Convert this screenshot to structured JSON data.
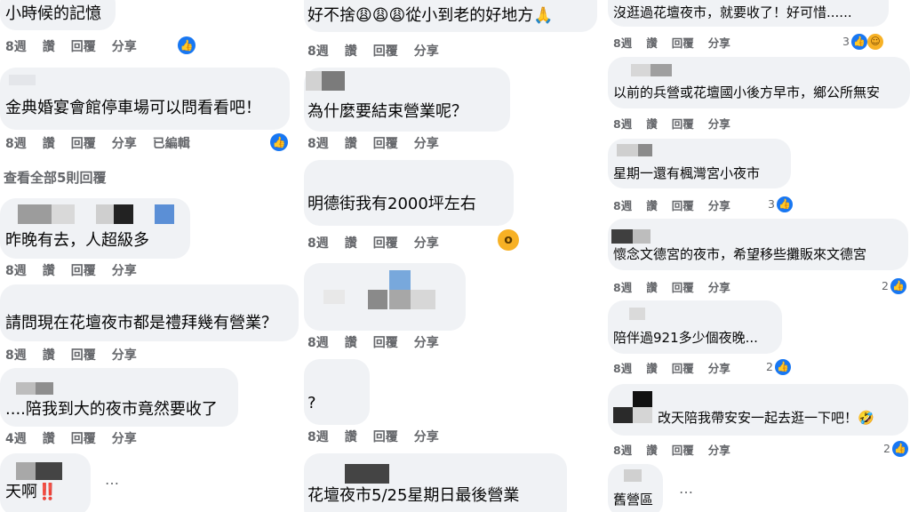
{
  "meta": {
    "reply_label": "回覆",
    "share_label": "分享",
    "edited_label": "已編輯"
  },
  "col1": {
    "c1": {
      "text": "小時候的記憶",
      "time": "8週",
      "read": "讚"
    },
    "c2": {
      "text": "金典婚宴會館停車場可以問看看吧！",
      "time": "8週",
      "read": "讚"
    },
    "view_all": "查看全部5則回覆",
    "c3": {
      "text": "昨晚有去，人超級多",
      "time": "8週",
      "read": "讚"
    },
    "c4": {
      "text": "請問現在花壇夜市都是禮拜幾有營業？",
      "time": "8週",
      "read": "讚"
    },
    "c5": {
      "text": "....陪我到大的夜市竟然要收了",
      "time": "4週",
      "read": "讚"
    },
    "c6": {
      "text": "天啊",
      "emoji": "‼️",
      "more": "…"
    }
  },
  "col2": {
    "c1": {
      "text_a": "好不捨",
      "emoji": "😩😩😩",
      "text_b": "從小到老的好地方",
      "pray": "🙏",
      "time": "8週",
      "read": "讚"
    },
    "c2": {
      "text": "為什麼要結束營業呢？",
      "time": "8週",
      "read": "讚"
    },
    "c3": {
      "text": "明德街我有2000坪左右",
      "time": "8週",
      "read": "讚"
    },
    "c4": {
      "time": "8週",
      "read": "讚"
    },
    "c5": {
      "text": "?",
      "time": "8週",
      "read": "讚"
    },
    "c6": {
      "text": "花壇夜市5/25星期日最後營業"
    }
  },
  "col3": {
    "c1": {
      "text": "沒逛過花壇夜市，就要收了！好可惜......",
      "time": "8週",
      "read": "讚",
      "count": "3"
    },
    "c2": {
      "text": "以前的兵營或花壇國小後方早市，鄉公所無安",
      "time": "8週",
      "read": "讚"
    },
    "c3": {
      "text": "星期一還有楓灣宮小夜市",
      "time": "8週",
      "read": "讚",
      "count": "3"
    },
    "c4": {
      "text": "懷念文德宮的夜市，希望移些攤販來文德宮",
      "time": "8週",
      "read": "讚",
      "count": "2"
    },
    "c5": {
      "text": "陪伴過921多少個夜晚...",
      "time": "8週",
      "read": "讚",
      "count": "2"
    },
    "c6": {
      "text": "改天陪我帶安安一起去逛一下吧！",
      "emoji": "🤣",
      "time": "8週",
      "read": "讚",
      "count": "2"
    },
    "c7": {
      "text": "舊營區",
      "more": "…"
    }
  },
  "colors": {
    "bubble": "#f0f2f5",
    "meta": "#65676b",
    "like": "#1877f2"
  }
}
